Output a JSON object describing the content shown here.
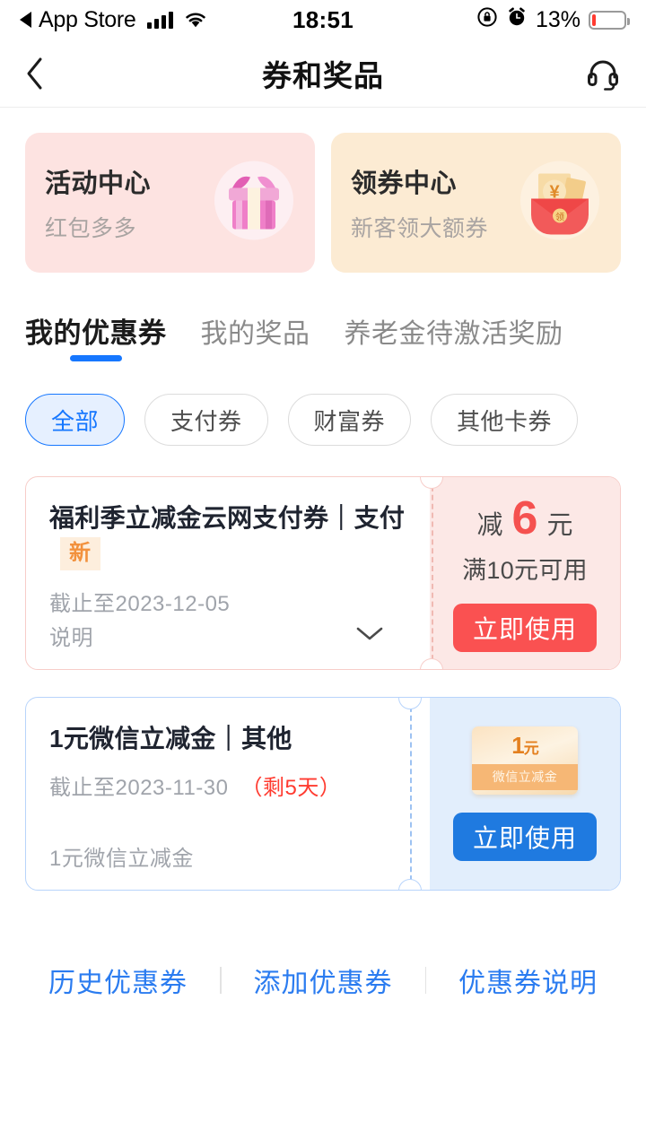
{
  "status_bar": {
    "return_app": "App Store",
    "time": "18:51",
    "battery_percent": "13%",
    "battery_level": 13,
    "icons": [
      "back-triangle-icon",
      "cellular-signal-icon",
      "wifi-icon",
      "rotation-lock-icon",
      "alarm-clock-icon",
      "battery-icon"
    ]
  },
  "header": {
    "title": "券和奖品",
    "back_icon": "chevron-left-icon",
    "support_icon": "headset-icon"
  },
  "banners": [
    {
      "title": "活动中心",
      "subtitle": "红包多多",
      "art": "gift-box-icon",
      "bg": "#fde3e1"
    },
    {
      "title": "领券中心",
      "subtitle": "新客领大额券",
      "art": "red-envelope-coupon-icon",
      "bg": "#fcebd3"
    }
  ],
  "tabs": [
    {
      "label": "我的优惠券",
      "active": true
    },
    {
      "label": "我的奖品",
      "active": false
    },
    {
      "label": "养老金待激活奖励",
      "active": false
    }
  ],
  "filters": [
    {
      "label": "全部",
      "active": true
    },
    {
      "label": "支付券",
      "active": false
    },
    {
      "label": "财富券",
      "active": false
    },
    {
      "label": "其他卡券",
      "active": false
    }
  ],
  "coupons": [
    {
      "title": "福利季立减金云网支付券｜支付",
      "badge": "新",
      "expiry": "截止至2023-12-05",
      "remaining": "",
      "description": "说明",
      "has_expand_chevron": true,
      "amount_prefix": "减",
      "amount": "6",
      "amount_unit": "元",
      "condition": "满10元可用",
      "action_label": "立即使用",
      "theme": "red"
    },
    {
      "title": "1元微信立减金｜其他",
      "badge": "",
      "expiry": "截止至2023-11-30",
      "remaining": "（剩5天）",
      "description": "1元微信立减金",
      "has_expand_chevron": false,
      "ticket_amount": "1",
      "ticket_unit": "元",
      "ticket_label": "微信立减金",
      "action_label": "立即使用",
      "theme": "blue"
    }
  ],
  "bottom_links": [
    {
      "label": "历史优惠券"
    },
    {
      "label": "添加优惠券"
    },
    {
      "label": "优惠券说明"
    }
  ],
  "colors": {
    "accent_blue": "#1677ff",
    "accent_red": "#fa5151",
    "warn_orange": "#f2913d",
    "link_blue": "#2b7cf0"
  }
}
